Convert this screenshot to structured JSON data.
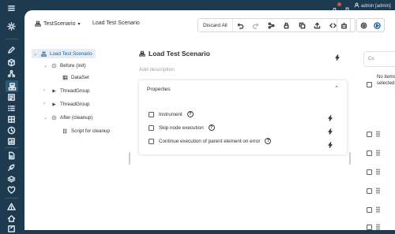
{
  "topbar": {
    "user_label": "admin [admin]"
  },
  "header": {
    "scenario_name": "TestScenario",
    "breadcrumb_title": "Load Test Scenario",
    "discard_label": "Discard All"
  },
  "tree": {
    "root": "Load Test Scenario",
    "before": "Before (init)",
    "dataset": "DataSet",
    "thread_group_1": "ThreadGroup",
    "thread_group_2": "ThreadGroup",
    "after": "After (cleanup)",
    "script": "Script for cleanup"
  },
  "main": {
    "title": "Load Test Scenario",
    "add_description": "Add description",
    "properties_header": "Properties",
    "properties": [
      {
        "label": "Instrument",
        "checked": false
      },
      {
        "label": "Skip node execution",
        "checked": false
      },
      {
        "label": "Continue execution of parent element on error",
        "checked": false
      }
    ]
  },
  "right_panel": {
    "tab_label": "Co",
    "no_items": "No items selected",
    "row_count": 6
  },
  "colors": {
    "sidebar": "#1e3a4f",
    "selected_text": "#1a5d96",
    "selected_bg": "#e6eef5"
  }
}
